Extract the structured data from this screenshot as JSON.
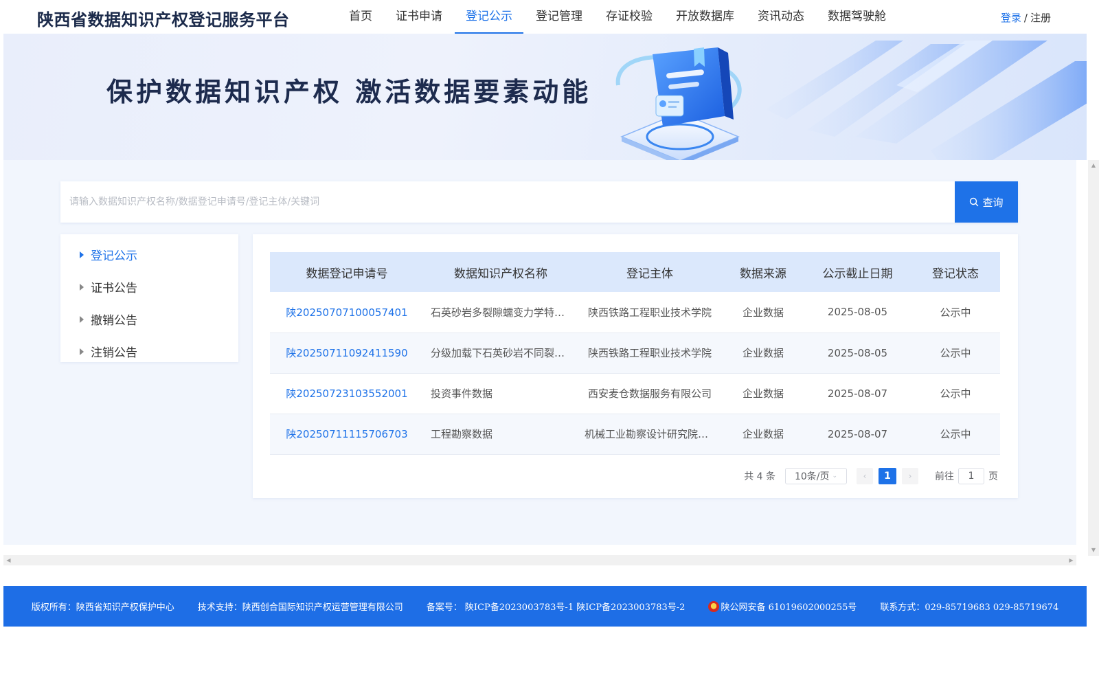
{
  "header": {
    "title": "陕西省数据知识产权登记服务平台",
    "nav": [
      {
        "label": "首页",
        "active": false
      },
      {
        "label": "证书申请",
        "active": false
      },
      {
        "label": "登记公示",
        "active": true
      },
      {
        "label": "登记管理",
        "active": false
      },
      {
        "label": "存证校验",
        "active": false
      },
      {
        "label": "开放数据库",
        "active": false
      },
      {
        "label": "资讯动态",
        "active": false
      },
      {
        "label": "数据驾驶舱",
        "active": false
      }
    ],
    "login_label": "登录",
    "separator": "/",
    "register_label": "注册"
  },
  "banner": {
    "slogan": "保护数据知识产权 激活数据要素动能"
  },
  "search": {
    "placeholder": "请输入数据知识产权名称/数据登记申请号/登记主体/关键词",
    "value": "",
    "button_label": "查询"
  },
  "sidebar": {
    "items": [
      {
        "label": "登记公示",
        "active": true
      },
      {
        "label": "证书公告",
        "active": false
      },
      {
        "label": "撤销公告",
        "active": false
      },
      {
        "label": "注销公告",
        "active": false
      }
    ]
  },
  "table": {
    "columns": [
      "数据登记申请号",
      "数据知识产权名称",
      "登记主体",
      "数据来源",
      "公示截止日期",
      "登记状态"
    ],
    "rows": [
      {
        "app_no": "陕20250707100057401",
        "name": "石英砂岩多裂隙蠕变力学特…",
        "subject": "陕西铁路工程职业技术学院",
        "source": "企业数据",
        "deadline": "2025-08-05",
        "status": "公示中"
      },
      {
        "app_no": "陕20250711092411590",
        "name": "分级加载下石英砂岩不同裂…",
        "subject": "陕西铁路工程职业技术学院",
        "source": "企业数据",
        "deadline": "2025-08-05",
        "status": "公示中"
      },
      {
        "app_no": "陕20250723103552001",
        "name": "投资事件数据",
        "subject": "西安麦仓数据服务有限公司",
        "source": "企业数据",
        "deadline": "2025-08-07",
        "status": "公示中"
      },
      {
        "app_no": "陕20250711115706703",
        "name": "工程勘察数据",
        "subject": "机械工业勘察设计研究院有…",
        "source": "企业数据",
        "deadline": "2025-08-07",
        "status": "公示中"
      }
    ]
  },
  "pagination": {
    "total_text": "共 4 条",
    "page_size_text": "10条/页",
    "current_page": "1",
    "goto_prefix": "前往",
    "goto_value": "1",
    "goto_suffix": "页"
  },
  "footer": {
    "copyright": "版权所有：陕西省知识产权保护中心",
    "tech_support": "技术支持：陕西创合国际知识产权运营管理有限公司",
    "icp": "备案号： 陕ICP备2023003783号-1 陕ICP备2023003783号-2",
    "police": "陕公网安备 61019602000255号",
    "contact": "联系方式：029-85719683 029-85719674"
  },
  "colors": {
    "accent": "#1e72e8",
    "footer_bg": "#1e6ee6",
    "table_header_bg": "#dbe8fc"
  }
}
